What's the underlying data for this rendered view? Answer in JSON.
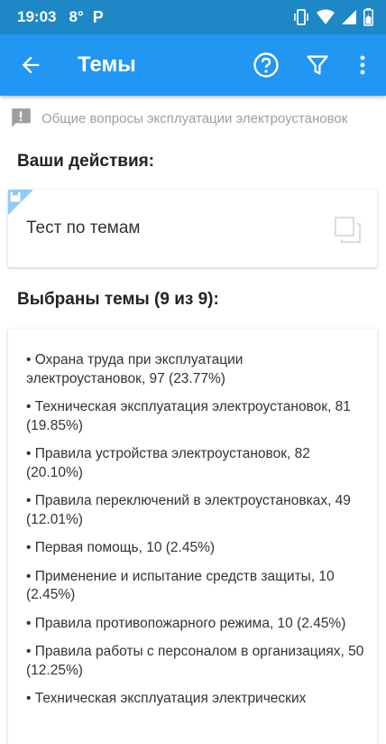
{
  "status_bar": {
    "time": "19:03",
    "temperature": "8°",
    "notification_letter": "P"
  },
  "app_bar": {
    "title": "Темы",
    "icons": {
      "back": "arrow-back-icon",
      "help": "help-circle-icon",
      "filter": "filter-icon",
      "menu": "more-vert-icon"
    }
  },
  "category": {
    "icon": "comment-alert-icon",
    "text": "Общие вопросы эксплуатации электроустановок"
  },
  "actions": {
    "heading": "Ваши действия:",
    "test_label": "Тест по темам"
  },
  "topics": {
    "heading": "Выбраны темы (9 из 9):",
    "items": [
      "• Охрана труда при эксплуатации электроустановок, 97 (23.77%)",
      "• Техническая эксплуатация электроустановок, 81 (19.85%)",
      "• Правила устройства электроустановок, 82 (20.10%)",
      "• Правила переключений в электроустановках, 49 (12.01%)",
      "• Первая помощь, 10 (2.45%)",
      "• Применение и испытание средств защиты, 10 (2.45%)",
      "• Правила противопожарного режима, 10 (2.45%)",
      "• Правила работы с персоналом в организациях, 50 (12.25%)",
      "• Техническая эксплуатация электрических"
    ]
  },
  "colors": {
    "status_bar": "#1e88c7",
    "app_bar": "#2196f3",
    "card_corner": "#90caf9"
  }
}
